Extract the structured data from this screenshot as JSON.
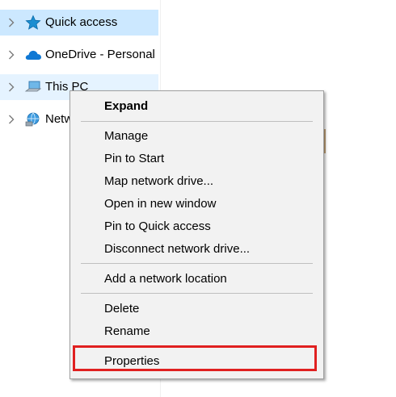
{
  "nav_pane": {
    "items": [
      {
        "label": "Quick access",
        "icon": "star-icon",
        "state": "selected"
      },
      {
        "label": "OneDrive - Personal",
        "icon": "onedrive-cloud-icon",
        "state": "normal"
      },
      {
        "label": "This PC",
        "icon": "computer-icon",
        "state": "hover"
      },
      {
        "label": "Netw",
        "icon": "network-icon",
        "state": "normal"
      }
    ]
  },
  "context_menu": {
    "items": [
      {
        "label": "Expand",
        "bold": true
      },
      {
        "label": "Manage"
      },
      {
        "label": "Pin to Start"
      },
      {
        "label": "Map network drive..."
      },
      {
        "label": "Open in new window"
      },
      {
        "label": "Pin to Quick access"
      },
      {
        "label": "Disconnect network drive..."
      },
      {
        "label": "Add a network location"
      },
      {
        "label": "Delete"
      },
      {
        "label": "Rename"
      },
      {
        "label": "Properties",
        "highlighted": true
      }
    ],
    "highlight_color": "#e02020"
  },
  "colors": {
    "selected_bg": "#cce8ff",
    "hover_bg": "#e5f3ff",
    "menu_bg": "#f2f2f2"
  }
}
